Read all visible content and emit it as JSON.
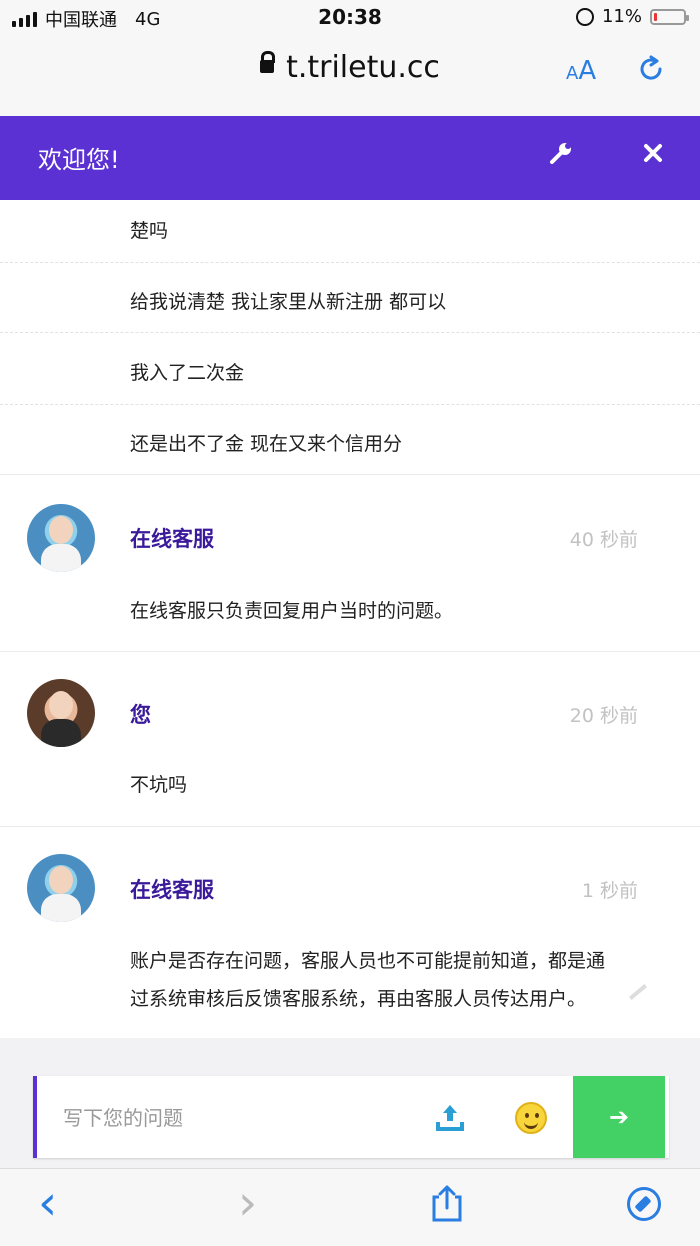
{
  "status_bar": {
    "carrier": "中国联通",
    "network": "4G",
    "time": "20:38",
    "battery": "11%",
    "battery_level": 0.11
  },
  "browser": {
    "url": "t.triletu.cc",
    "text_size_small": "A",
    "text_size_large": "A"
  },
  "header": {
    "title": "欢迎您!",
    "wrench_icon": "wrench-icon",
    "close_icon": "close-icon",
    "color": "#5b31d3"
  },
  "messages": {
    "earlier_lines": [
      "楚吗",
      "给我说清楚 我让家里从新注册 都可以",
      "我入了二次金",
      "还是出不了金 现在又来个信用分"
    ],
    "items": [
      {
        "sender": "在线客服",
        "time": "40 秒前",
        "text_lines": [
          "在线客服只负责回复用户当时的问题。"
        ]
      },
      {
        "sender": "您",
        "time": "20 秒前",
        "text_lines": [
          "不坑吗"
        ]
      },
      {
        "sender": "在线客服",
        "time": "1 秒前",
        "text_lines": [
          "账户是否存在问题，客服人员也不可能提前知道，都是通",
          "过系统审核后反馈客服系统，再由客服人员传达用户。"
        ]
      }
    ]
  },
  "input": {
    "placeholder": "写下您的问题",
    "send_label": "➔",
    "send_color": "#43d064"
  },
  "toolbar": {
    "back_label": "‹",
    "forward_label": "›"
  }
}
